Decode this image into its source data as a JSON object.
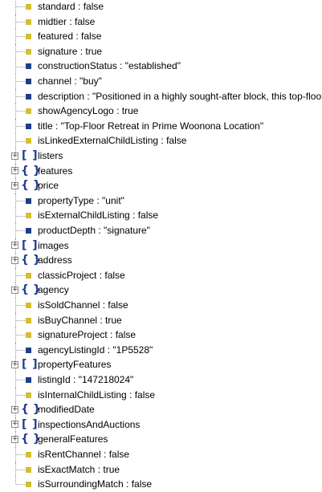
{
  "colors": {
    "boolean_icon": "#d6be2e",
    "string_icon": "#1d3f86",
    "container_icon": "#1f3f8f",
    "tree_line": "#9a9a9a"
  },
  "tree": [
    {
      "type": "boolean",
      "text": "standard : false",
      "name": "property-standard"
    },
    {
      "type": "boolean",
      "text": "midtier : false",
      "name": "property-midtier"
    },
    {
      "type": "boolean",
      "text": "featured : false",
      "name": "property-featured"
    },
    {
      "type": "boolean",
      "text": "signature : true",
      "name": "property-signature"
    },
    {
      "type": "string",
      "text": "constructionStatus : \"established\"",
      "name": "property-constructionstatus"
    },
    {
      "type": "string",
      "text": "channel : \"buy\"",
      "name": "property-channel"
    },
    {
      "type": "string",
      "text": "description : \"Positioned in a highly sought-after block, this top-floor",
      "name": "property-description"
    },
    {
      "type": "boolean",
      "text": "showAgencyLogo : true",
      "name": "property-showagencylogo"
    },
    {
      "type": "string",
      "text": "title : \"Top-Floor Retreat in Prime Woonona Location\"",
      "name": "property-title"
    },
    {
      "type": "boolean",
      "text": "isLinkedExternalChildListing : false",
      "name": "property-islinkedexternalchildlisting"
    },
    {
      "type": "array",
      "text": "listers",
      "name": "node-listers"
    },
    {
      "type": "object",
      "text": "features",
      "name": "node-features"
    },
    {
      "type": "object",
      "text": "price",
      "name": "node-price"
    },
    {
      "type": "string",
      "text": "propertyType : \"unit\"",
      "name": "property-propertytype"
    },
    {
      "type": "boolean",
      "text": "isExternalChildListing : false",
      "name": "property-isexternalchildlisting"
    },
    {
      "type": "string",
      "text": "productDepth : \"signature\"",
      "name": "property-productdepth"
    },
    {
      "type": "array",
      "text": "images",
      "name": "node-images"
    },
    {
      "type": "object",
      "text": "address",
      "name": "node-address"
    },
    {
      "type": "boolean",
      "text": "classicProject : false",
      "name": "property-classicproject"
    },
    {
      "type": "object",
      "text": "agency",
      "name": "node-agency"
    },
    {
      "type": "boolean",
      "text": "isSoldChannel : false",
      "name": "property-issoldchannel"
    },
    {
      "type": "boolean",
      "text": "isBuyChannel : true",
      "name": "property-isbuychannel"
    },
    {
      "type": "boolean",
      "text": "signatureProject : false",
      "name": "property-signatureproject"
    },
    {
      "type": "string",
      "text": "agencyListingId : \"1P5528\"",
      "name": "property-agencylistingid"
    },
    {
      "type": "array",
      "text": "propertyFeatures",
      "name": "node-propertyfeatures"
    },
    {
      "type": "string",
      "text": "listingId : \"147218024\"",
      "name": "property-listingid"
    },
    {
      "type": "boolean",
      "text": "isInternalChildListing : false",
      "name": "property-isinternalchildlisting"
    },
    {
      "type": "object",
      "text": "modifiedDate",
      "name": "node-modifieddate"
    },
    {
      "type": "array",
      "text": "inspectionsAndAuctions",
      "name": "node-inspectionsandauctions"
    },
    {
      "type": "object",
      "text": "generalFeatures",
      "name": "node-generalfeatures"
    },
    {
      "type": "boolean",
      "text": "isRentChannel : false",
      "name": "property-isrentchannel"
    },
    {
      "type": "boolean",
      "text": "isExactMatch : true",
      "name": "property-isexactmatch"
    },
    {
      "type": "boolean",
      "text": "isSurroundingMatch : false",
      "name": "property-issurroundingmatch"
    }
  ]
}
